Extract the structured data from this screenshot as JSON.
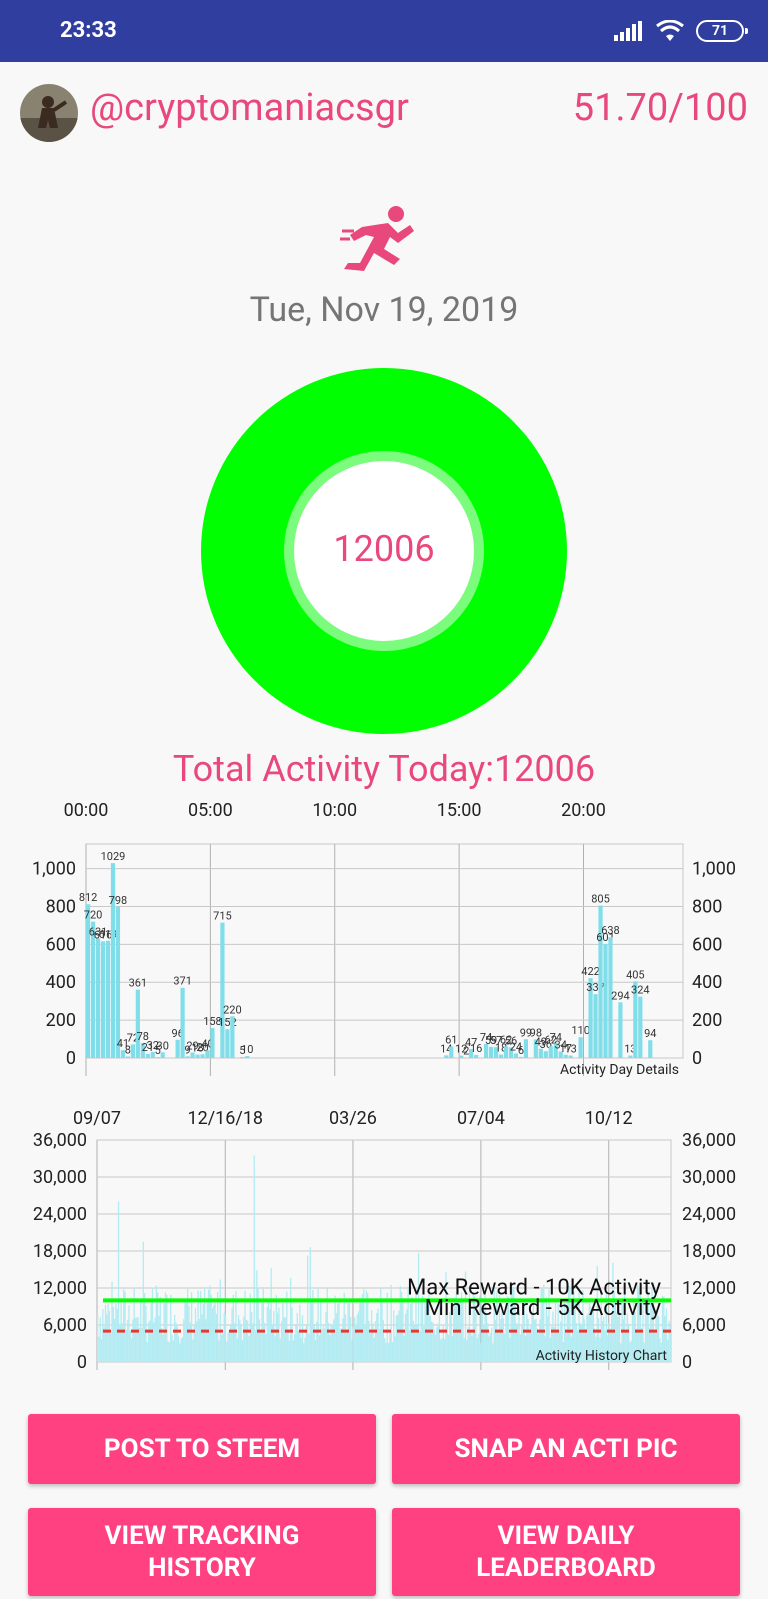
{
  "status_bar": {
    "time": "23:33",
    "battery": "71",
    "icons": [
      "signal-icon",
      "wifi-icon",
      "battery-icon"
    ]
  },
  "profile": {
    "username": "@cryptomaniacsgr",
    "score": "51.70/100"
  },
  "date": "Tue, Nov 19, 2019",
  "ring": {
    "value": "12006",
    "outer_color": "#00ff00",
    "inner_color": "#7cfc7c"
  },
  "total_activity": "Total Activity Today:12006",
  "colors": {
    "accent": "#e8487c",
    "button": "#ff4081",
    "status_bar": "#303f9f",
    "bar": "#80deea",
    "max_line": "#00ff00",
    "min_line": "#e53935"
  },
  "buttons": {
    "post": "POST TO STEEM",
    "snap": "SNAP AN ACTI PIC",
    "history": "VIEW TRACKING\nHISTORY",
    "leaderboard": "VIEW DAILY\nLEADERBOARD"
  },
  "chart_data": [
    {
      "type": "bar",
      "description": "Activity Day Details",
      "x_ticks": [
        "00:00",
        "05:00",
        "10:00",
        "15:00",
        "20:00"
      ],
      "y_ticks": [
        "0",
        "200",
        "400",
        "600",
        "800",
        "1,000"
      ],
      "ylim": [
        0,
        1130
      ],
      "x_range_hours": [
        0,
        24
      ],
      "hour_ticks": [
        0,
        5,
        10,
        15,
        20
      ],
      "y_values_ticks": [
        0,
        200,
        400,
        600,
        800,
        1000
      ],
      "grid": true,
      "bars": [
        {
          "hour": 0.0,
          "value": 812
        },
        {
          "hour": 0.2,
          "value": 720
        },
        {
          "hour": 0.4,
          "value": 631
        },
        {
          "hour": 0.6,
          "value": 616
        },
        {
          "hour": 0.8,
          "value": 619
        },
        {
          "hour": 1.0,
          "value": 1029
        },
        {
          "hour": 1.2,
          "value": 798
        },
        {
          "hour": 1.4,
          "value": 41
        },
        {
          "hour": 1.6,
          "value": 8
        },
        {
          "hour": 1.8,
          "value": 72
        },
        {
          "hour": 2.0,
          "value": 361
        },
        {
          "hour": 2.2,
          "value": 78
        },
        {
          "hour": 2.4,
          "value": 21
        },
        {
          "hour": 2.6,
          "value": 32
        },
        {
          "hour": 2.8,
          "value": 5
        },
        {
          "hour": 3.0,
          "value": 30
        },
        {
          "hour": 3.6,
          "value": 96
        },
        {
          "hour": 3.8,
          "value": 371
        },
        {
          "hour": 4.0,
          "value": 9
        },
        {
          "hour": 4.2,
          "value": 29
        },
        {
          "hour": 4.4,
          "value": 18
        },
        {
          "hour": 4.6,
          "value": 20
        },
        {
          "hour": 4.8,
          "value": 40
        },
        {
          "hour": 5.0,
          "value": 158
        },
        {
          "hour": 5.4,
          "value": 715
        },
        {
          "hour": 5.6,
          "value": 152
        },
        {
          "hour": 5.8,
          "value": 220
        },
        {
          "hour": 6.2,
          "value": 5
        },
        {
          "hour": 6.4,
          "value": 10
        },
        {
          "hour": 14.4,
          "value": 14
        },
        {
          "hour": 14.6,
          "value": 61
        },
        {
          "hour": 15.0,
          "value": 12
        },
        {
          "hour": 15.2,
          "value": 2
        },
        {
          "hour": 15.4,
          "value": 47
        },
        {
          "hour": 15.6,
          "value": 16
        },
        {
          "hour": 16.0,
          "value": 74
        },
        {
          "hour": 16.2,
          "value": 59
        },
        {
          "hour": 16.4,
          "value": 57
        },
        {
          "hour": 16.6,
          "value": 18
        },
        {
          "hour": 16.8,
          "value": 62
        },
        {
          "hour": 17.0,
          "value": 56
        },
        {
          "hour": 17.2,
          "value": 24
        },
        {
          "hour": 17.4,
          "value": 6
        },
        {
          "hour": 17.6,
          "value": 99
        },
        {
          "hour": 18.0,
          "value": 98
        },
        {
          "hour": 18.2,
          "value": 49
        },
        {
          "hour": 18.4,
          "value": 36
        },
        {
          "hour": 18.6,
          "value": 62
        },
        {
          "hour": 18.8,
          "value": 74
        },
        {
          "hour": 19.0,
          "value": 34
        },
        {
          "hour": 19.2,
          "value": 17
        },
        {
          "hour": 19.4,
          "value": 13
        },
        {
          "hour": 19.8,
          "value": 110
        },
        {
          "hour": 20.2,
          "value": 422
        },
        {
          "hour": 20.4,
          "value": 337
        },
        {
          "hour": 20.6,
          "value": 805
        },
        {
          "hour": 20.8,
          "value": 601
        },
        {
          "hour": 21.0,
          "value": 638
        },
        {
          "hour": 21.4,
          "value": 294
        },
        {
          "hour": 21.8,
          "value": 13
        },
        {
          "hour": 22.0,
          "value": 405
        },
        {
          "hour": 22.2,
          "value": 324
        },
        {
          "hour": 22.6,
          "value": 94
        }
      ]
    },
    {
      "type": "bar",
      "description": "Activity History Chart",
      "x_ticks": [
        "09/07",
        "12/16/18",
        "03/26",
        "07/04",
        "10/12"
      ],
      "y_ticks": [
        "0",
        "6,000",
        "12,000",
        "18,000",
        "24,000",
        "30,000",
        "36,000"
      ],
      "ylim": [
        0,
        36000
      ],
      "y_values_ticks": [
        0,
        6000,
        12000,
        18000,
        24000,
        30000,
        36000
      ],
      "grid": true,
      "days": 440,
      "reference_lines": [
        {
          "label": "Max Reward - 10K Activity",
          "value": 10000,
          "style": "solid",
          "color": "#00ff00"
        },
        {
          "label": "Min Reward - 5K Activity",
          "value": 5000,
          "style": "dashed",
          "color": "#e53935"
        }
      ]
    }
  ]
}
